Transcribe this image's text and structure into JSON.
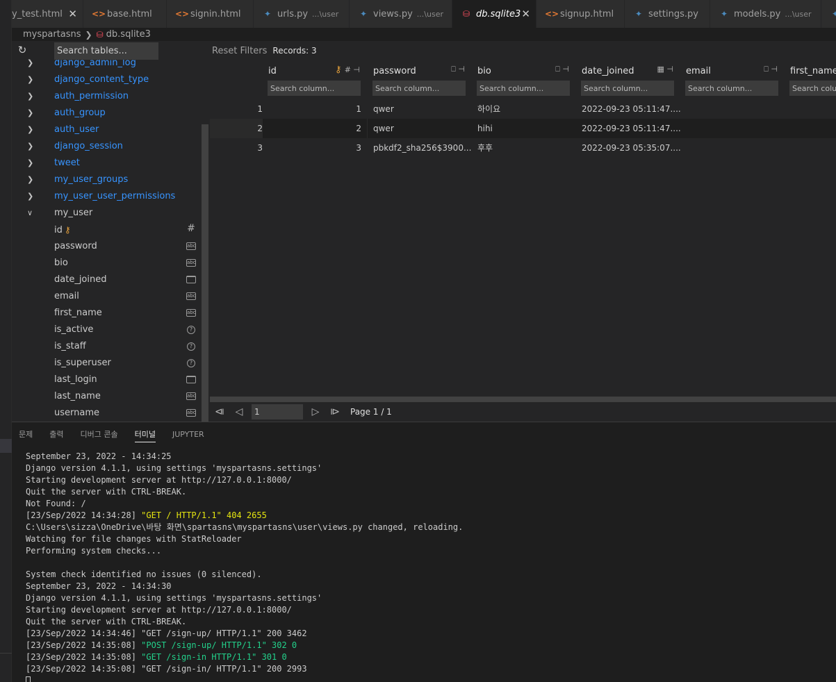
{
  "tabs": [
    {
      "label": "y_test.html",
      "icon": "<>",
      "kind": "html",
      "closable": true,
      "width": 103
    },
    {
      "label": "base.html",
      "icon": "<>",
      "kind": "html",
      "closable": false,
      "width": 120
    },
    {
      "label": "signin.html",
      "icon": "<>",
      "kind": "html",
      "closable": false,
      "width": 125
    },
    {
      "label": "urls.py",
      "desc": "...\\user",
      "icon": "✦",
      "kind": "py",
      "closable": false,
      "width": 138
    },
    {
      "label": "views.py",
      "desc": "...\\user",
      "icon": "✦",
      "kind": "py",
      "closable": false,
      "width": 148
    },
    {
      "label": "db.sqlite3",
      "icon": "⛁",
      "kind": "db",
      "closable": true,
      "active": true,
      "width": 121
    },
    {
      "label": "signup.html",
      "icon": "<>",
      "kind": "html",
      "closable": false,
      "width": 127
    },
    {
      "label": "settings.py",
      "icon": "✦",
      "kind": "py",
      "closable": false,
      "width": 123
    },
    {
      "label": "models.py",
      "desc": "...\\user",
      "icon": "✦",
      "kind": "py",
      "closable": false,
      "width": 160
    },
    {
      "label": "",
      "icon": "✦",
      "kind": "py",
      "closable": false,
      "width": 40
    }
  ],
  "breadcrumb": {
    "folder": "myspartasns",
    "file": "db.sqlite3"
  },
  "sidebar": {
    "search_placeholder": "Search tables...",
    "tables": [
      "django_admin_log",
      "django_content_type",
      "auth_permission",
      "auth_group",
      "auth_user",
      "django_session",
      "tweet",
      "my_user_groups",
      "my_user_user_permissions"
    ],
    "open_table": "my_user",
    "columns": [
      {
        "name": "id",
        "type": "hash",
        "pk": true
      },
      {
        "name": "password",
        "type": "abc"
      },
      {
        "name": "bio",
        "type": "abc"
      },
      {
        "name": "date_joined",
        "type": "cal"
      },
      {
        "name": "email",
        "type": "abc"
      },
      {
        "name": "first_name",
        "type": "abc"
      },
      {
        "name": "is_active",
        "type": "bool"
      },
      {
        "name": "is_staff",
        "type": "bool"
      },
      {
        "name": "is_superuser",
        "type": "bool"
      },
      {
        "name": "last_login",
        "type": "cal"
      },
      {
        "name": "last_name",
        "type": "abc"
      },
      {
        "name": "username",
        "type": "abc"
      }
    ]
  },
  "grid": {
    "reset_label": "Reset Filters",
    "records_label": "Records: 3",
    "search_placeholder": "Search column...",
    "columns": [
      {
        "name": "id",
        "pk": true,
        "type": "#"
      },
      {
        "name": "password",
        "type": "abc"
      },
      {
        "name": "bio",
        "type": "abc"
      },
      {
        "name": "date_joined",
        "type": "cal"
      },
      {
        "name": "email",
        "type": "abc"
      },
      {
        "name": "first_name",
        "type": "abc"
      }
    ],
    "rows": [
      {
        "row": "1",
        "cells": [
          "1",
          "qwer",
          "하이요",
          "2022-09-23 05:11:47....",
          "",
          ""
        ]
      },
      {
        "row": "2",
        "cells": [
          "2",
          "qwer",
          "hihi",
          "2022-09-23 05:11:47....",
          "",
          ""
        ]
      },
      {
        "row": "3",
        "cells": [
          "3",
          "pbkdf2_sha256$3900...",
          "후후",
          "2022-09-23 05:35:07....",
          "",
          ""
        ]
      }
    ],
    "page_value": "1",
    "page_label": "Page 1 / 1"
  },
  "panel": {
    "tabs": [
      "문제",
      "출력",
      "디버그 콘솔",
      "터미널",
      "JUPYTER"
    ],
    "active_tab": 3,
    "terminal_lines": [
      {
        "t": "September 23, 2022 - 14:34:25"
      },
      {
        "t": "Django version 4.1.1, using settings 'myspartasns.settings'"
      },
      {
        "t": "Starting development server at http://127.0.0.1:8000/"
      },
      {
        "t": "Quit the server with CTRL-BREAK."
      },
      {
        "t": "Not Found: /"
      },
      {
        "p": "[23/Sep/2022 14:34:28] ",
        "h": "\"GET / HTTP/1.1\" 404 2655",
        "c": "y"
      },
      {
        "t": "C:\\Users\\sizza\\OneDrive\\바탕 화면\\spartasns\\myspartasns\\user\\views.py changed, reloading."
      },
      {
        "t": "Watching for file changes with StatReloader"
      },
      {
        "t": "Performing system checks..."
      },
      {
        "t": ""
      },
      {
        "t": "System check identified no issues (0 silenced)."
      },
      {
        "t": "September 23, 2022 - 14:34:30"
      },
      {
        "t": "Django version 4.1.1, using settings 'myspartasns.settings'"
      },
      {
        "t": "Starting development server at http://127.0.0.1:8000/"
      },
      {
        "t": "Quit the server with CTRL-BREAK."
      },
      {
        "t": "[23/Sep/2022 14:34:46] \"GET /sign-up/ HTTP/1.1\" 200 3462"
      },
      {
        "p": "[23/Sep/2022 14:35:08] ",
        "h": "\"POST /sign-up/ HTTP/1.1\" 302 0",
        "c": "g"
      },
      {
        "p": "[23/Sep/2022 14:35:08] ",
        "h": "\"GET /sign-in HTTP/1.1\" 301 0",
        "c": "g"
      },
      {
        "t": "[23/Sep/2022 14:35:08] \"GET /sign-in/ HTTP/1.1\" 200 2993"
      }
    ]
  },
  "colors": {
    "accent_link": "#3794ff",
    "pk_key": "#e8a33c",
    "term_yellow": "#e5e510",
    "term_green": "#23d18b",
    "db_icon": "#f14c5c"
  }
}
